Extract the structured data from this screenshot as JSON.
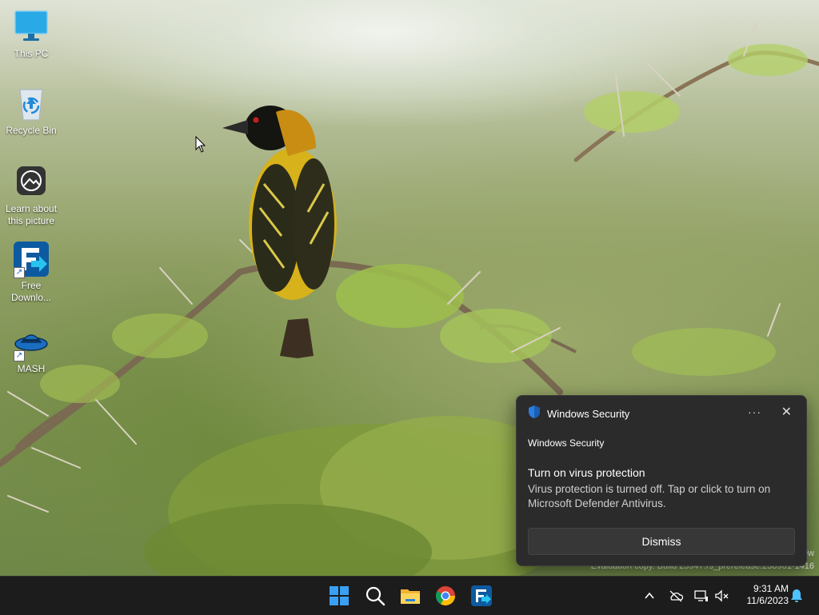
{
  "desktop": {
    "icons": [
      {
        "label": "This PC",
        "icon": "monitor-icon"
      },
      {
        "label": "Recycle Bin",
        "icon": "recycle-bin-icon"
      },
      {
        "label": "Learn about this picture",
        "icon": "camera-icon"
      },
      {
        "label": "Free Downlo...",
        "icon": "free-download-manager-icon"
      },
      {
        "label": "MASH",
        "icon": "mash-icon"
      }
    ]
  },
  "toast": {
    "app_name": "Windows Security",
    "source": "Windows Security",
    "title": "Turn on virus protection",
    "body": "Virus protection is turned off. Tap or click to turn on Microsoft Defender Antivirus.",
    "dismiss_label": "Dismiss",
    "more_glyph": "···",
    "close_glyph": "✕"
  },
  "watermark": {
    "line1": "ew",
    "line2": "Evaluation copy. Build 25947.rs_prerelease.230901-1416"
  },
  "taskbar": {
    "pinned": [
      "start-icon",
      "search-icon",
      "file-explorer-icon",
      "chrome-icon",
      "free-download-manager-icon"
    ],
    "tray": [
      "chevron-up-icon",
      "onedrive-icon",
      "network-icon",
      "volume-muted-icon",
      "notification-bell-icon"
    ],
    "time": "9:31 AM",
    "date": "11/6/2023"
  },
  "colors": {
    "taskbar_bg": "#1c1c1c",
    "toast_bg": "#2b2b2b",
    "accent": "#0078d4"
  }
}
